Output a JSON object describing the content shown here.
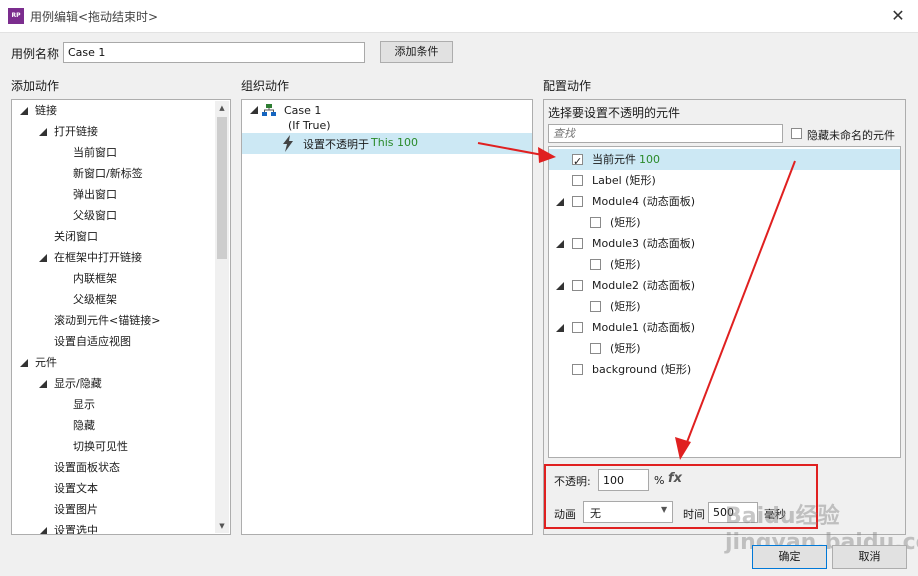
{
  "window": {
    "title": "用例编辑<拖动结束时>",
    "app_icon": "RP",
    "close_icon": "close-icon"
  },
  "case_name": {
    "label": "用例名称",
    "value": "Case 1",
    "add_condition": "添加条件"
  },
  "add_actions": {
    "title": "添加动作",
    "items": [
      {
        "label": "链接",
        "level": 0,
        "expand": true
      },
      {
        "label": "打开链接",
        "level": 1,
        "expand": true
      },
      {
        "label": "当前窗口",
        "level": 2
      },
      {
        "label": "新窗口/新标签",
        "level": 2
      },
      {
        "label": "弹出窗口",
        "level": 2
      },
      {
        "label": "父级窗口",
        "level": 2
      },
      {
        "label": "关闭窗口",
        "level": 1
      },
      {
        "label": "在框架中打开链接",
        "level": 1,
        "expand": true
      },
      {
        "label": "内联框架",
        "level": 2
      },
      {
        "label": "父级框架",
        "level": 2
      },
      {
        "label": "滚动到元件<锚链接>",
        "level": 1
      },
      {
        "label": "设置自适应视图",
        "level": 1
      },
      {
        "label": "元件",
        "level": 0,
        "expand": true
      },
      {
        "label": "显示/隐藏",
        "level": 1,
        "expand": true
      },
      {
        "label": "显示",
        "level": 2
      },
      {
        "label": "隐藏",
        "level": 2
      },
      {
        "label": "切换可见性",
        "level": 2
      },
      {
        "label": "设置面板状态",
        "level": 1
      },
      {
        "label": "设置文本",
        "level": 1
      },
      {
        "label": "设置图片",
        "level": 1
      },
      {
        "label": "设置选中",
        "level": 1,
        "expand": true
      }
    ]
  },
  "organize": {
    "title": "组织动作",
    "case_label": "Case 1",
    "condition": "(If True)",
    "action_prefix": "设置不透明于",
    "action_target": "This 100"
  },
  "configure": {
    "title": "配置动作",
    "subtitle": "选择要设置不透明的元件",
    "search_placeholder": "查找",
    "hide_unnamed": "隐藏未命名的元件",
    "widgets": [
      {
        "label": "当前元件",
        "suffix": "100",
        "checked": true,
        "expand": false,
        "indent": 0,
        "selected": true
      },
      {
        "label": "Label (矩形)",
        "suffix": "",
        "checked": false,
        "expand": false,
        "indent": 0
      },
      {
        "label": "Module4 (动态面板)",
        "suffix": "",
        "checked": false,
        "expand": true,
        "indent": 0
      },
      {
        "label": "(矩形)",
        "suffix": "",
        "checked": false,
        "expand": false,
        "indent": 1
      },
      {
        "label": "Module3 (动态面板)",
        "suffix": "",
        "checked": false,
        "expand": true,
        "indent": 0
      },
      {
        "label": "(矩形)",
        "suffix": "",
        "checked": false,
        "expand": false,
        "indent": 1
      },
      {
        "label": "Module2 (动态面板)",
        "suffix": "",
        "checked": false,
        "expand": true,
        "indent": 0
      },
      {
        "label": "(矩形)",
        "suffix": "",
        "checked": false,
        "expand": false,
        "indent": 1
      },
      {
        "label": "Module1 (动态面板)",
        "suffix": "",
        "checked": false,
        "expand": true,
        "indent": 0
      },
      {
        "label": "(矩形)",
        "suffix": "",
        "checked": false,
        "expand": false,
        "indent": 1
      },
      {
        "label": "background (矩形)",
        "suffix": "",
        "checked": false,
        "expand": false,
        "indent": 0
      }
    ],
    "opacity_label": "不透明:",
    "opacity_value": "100",
    "percent": "%",
    "fx": "fx",
    "animation_label": "动画",
    "animation_value": "无",
    "time_label": "时间",
    "time_value": "500",
    "ms_label": "毫秒"
  },
  "footer": {
    "ok": "确定",
    "cancel": "取消"
  },
  "watermark": "Baidu经验 jingyan.baidu.com",
  "colors": {
    "annotation": "#e02020",
    "selection": "#cce8f4",
    "green_text": "#2a8a2a"
  }
}
